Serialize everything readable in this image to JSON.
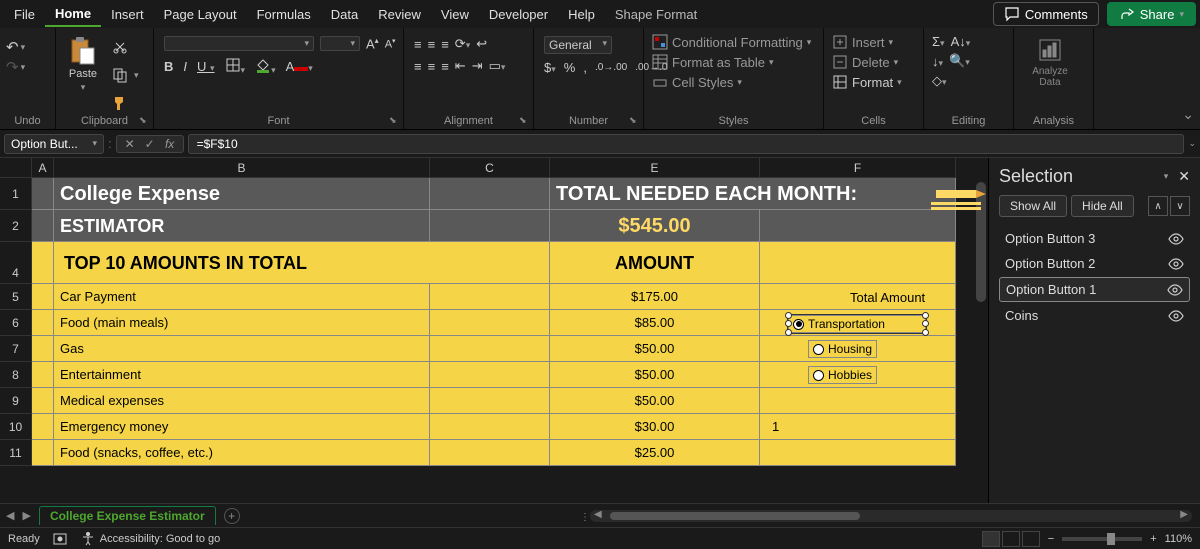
{
  "menu": {
    "items": [
      "File",
      "Home",
      "Insert",
      "Page Layout",
      "Formulas",
      "Data",
      "Review",
      "View",
      "Developer",
      "Help",
      "Shape Format"
    ],
    "active": "Home",
    "comments": "Comments",
    "share": "Share"
  },
  "ribbon": {
    "undo": "Undo",
    "clipboard": "Clipboard",
    "paste": "Paste",
    "font": "Font",
    "alignment": "Alignment",
    "number": "Number",
    "general": "General",
    "styles": "Styles",
    "cond_fmt": "Conditional Formatting",
    "fmt_table": "Format as Table",
    "cell_styles": "Cell Styles",
    "cells": "Cells",
    "insert": "Insert",
    "delete": "Delete",
    "format": "Format",
    "editing": "Editing",
    "analysis": "Analysis",
    "analyze_data": "Analyze\nData"
  },
  "formula": {
    "namebox": "Option But...",
    "value": "=$F$10"
  },
  "sheet": {
    "columns": [
      "A",
      "B",
      "C",
      "E",
      "F"
    ],
    "title": "College Expense",
    "subtitle": "ESTIMATOR",
    "total_label": "TOTAL NEEDED EACH MONTH:",
    "total_value": "$545.00",
    "top10_label": "TOP 10 AMOUNTS IN TOTAL",
    "amount_label": "AMOUNT",
    "total_amount_label": "Total Amount",
    "rows": [
      {
        "n": "5",
        "label": "Car Payment",
        "amount": "$175.00",
        "f": ""
      },
      {
        "n": "6",
        "label": "Food (main meals)",
        "amount": "$85.00",
        "f": ""
      },
      {
        "n": "7",
        "label": "Gas",
        "amount": "$50.00",
        "f": ""
      },
      {
        "n": "8",
        "label": "Entertainment",
        "amount": "$50.00",
        "f": ""
      },
      {
        "n": "9",
        "label": "Medical expenses",
        "amount": "$50.00",
        "f": ""
      },
      {
        "n": "10",
        "label": "Emergency money",
        "amount": "$30.00",
        "f": "1"
      },
      {
        "n": "11",
        "label": "Food (snacks, coffee, etc.)",
        "amount": "$25.00",
        "f": ""
      }
    ],
    "options": {
      "transportation": "Transportation",
      "housing": "Housing",
      "hobbies": "Hobbies"
    },
    "tab": "College Expense Estimator"
  },
  "selection_pane": {
    "title": "Selection",
    "show_all": "Show All",
    "hide_all": "Hide All",
    "items": [
      "Option Button 3",
      "Option Button 2",
      "Option Button 1",
      "Coins"
    ],
    "selected": "Option Button 1"
  },
  "status": {
    "ready": "Ready",
    "accessibility": "Accessibility: Good to go",
    "zoom": "110%"
  }
}
